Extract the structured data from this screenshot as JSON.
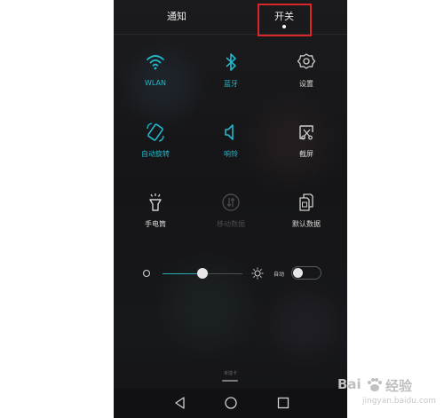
{
  "header": {
    "tabs": [
      {
        "label": "通知"
      },
      {
        "label": "开关"
      }
    ]
  },
  "toggles": [
    {
      "label": "WLAN",
      "icon": "wifi-icon",
      "state": "active"
    },
    {
      "label": "蓝牙",
      "icon": "bluetooth-icon",
      "state": "active"
    },
    {
      "label": "设置",
      "icon": "gear-icon",
      "state": "normal"
    },
    {
      "label": "自动旋转",
      "icon": "rotate-icon",
      "state": "active"
    },
    {
      "label": "响铃",
      "icon": "speaker-icon",
      "state": "active"
    },
    {
      "label": "截屏",
      "icon": "screenshot-icon",
      "state": "normal"
    },
    {
      "label": "手电筒",
      "icon": "flashlight-icon",
      "state": "normal"
    },
    {
      "label": "移动数据",
      "icon": "mobile-data-icon",
      "state": "disabled"
    },
    {
      "label": "默认数据",
      "icon": "sim-icon",
      "state": "normal"
    }
  ],
  "brightness": {
    "level": 0.48,
    "auto_label": "自动",
    "auto_enabled": false
  },
  "footer": {
    "sim_status": "未插卡"
  },
  "colors": {
    "accent": "#22b8cc",
    "highlight_box": "#d8262b",
    "background": "#17181b"
  },
  "watermark": {
    "main": "Bai",
    "sub": "经验",
    "url": "jingyan.baidu.com"
  }
}
